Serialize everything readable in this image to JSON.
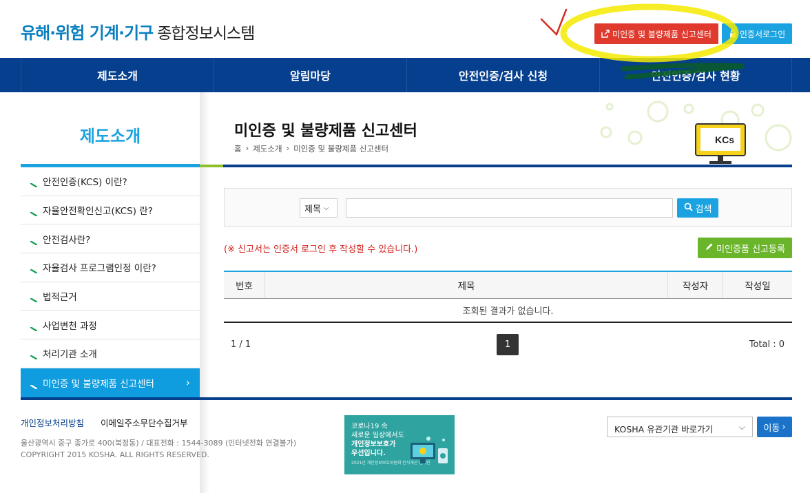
{
  "header": {
    "logo_blue": "유해·위험 기계·기구",
    "logo_dark": "종합정보시스템",
    "report_button": "미인증 및 불량제품 신고센터",
    "login_button": "인증서로그인"
  },
  "nav": {
    "items": [
      "제도소개",
      "알림마당",
      "안전인증/검사 신청",
      "안전인증/검사 현황"
    ]
  },
  "sidebar": {
    "title": "제도소개",
    "items": [
      "안전인증(KCS) 이란?",
      "자율안전확인신고(KCS) 란?",
      "안전검사란?",
      "자율검사 프로그램인정 이란?",
      "법적근거",
      "사업변천 과정",
      "처리기관 소개",
      "미인증 및 불량제품 신고센터"
    ]
  },
  "main": {
    "title": "미인증 및 불량제품 신고센터",
    "breadcrumb": [
      "홈",
      "제도소개",
      "미인증 및 불량제품 신고센터"
    ],
    "search": {
      "select_value": "제목",
      "input_value": "",
      "button": "검색"
    },
    "notice": "(※ 신고서는 인증서 로그인 후 작성할 수 있습니다.)",
    "register_button": "미인증품 신고등록",
    "table": {
      "headers": [
        "번호",
        "제목",
        "작성자",
        "작성일"
      ],
      "empty_message": "조회된 결과가 없습니다."
    },
    "pager": {
      "count": "1 / 1",
      "current_page": "1",
      "total": "Total : 0"
    },
    "kcs_mark": "KCs"
  },
  "footer": {
    "privacy_link": "개인정보처리방침",
    "email_link": "이메일주소무단수집거부",
    "address": "울산광역시 중구 종가로 400(북정동) / 대표전화 : 1544-3089 (인터넷전화 연결불가)",
    "copyright": "COPYRIGHT 2015 KOSHA. ALL RIGHTS RESERVED.",
    "banner": {
      "line1": "코로나19 속",
      "line2": "새로운 일상에서도",
      "line3": "개인정보보호가",
      "line4": "우선입니다.",
      "line5": "2021년 개인정보보호위원회 인식개선 캠페인"
    },
    "related_select": "KOSHA 유관기관 바로가기",
    "go_button": "이동"
  },
  "colors": {
    "nav_bg": "#053f8e",
    "accent_blue": "#1aa3e0",
    "report_red": "#e03a2e",
    "register_green": "#6bb52b",
    "highlight_yellow": "#f5ea00"
  }
}
